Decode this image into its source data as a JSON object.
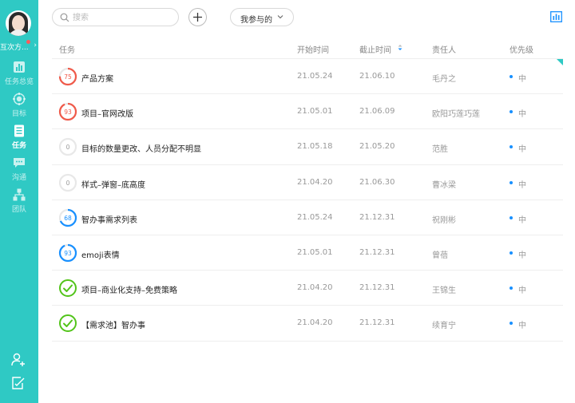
{
  "sidebar": {
    "team_name": "互次方...",
    "items": [
      {
        "label": "任务总览",
        "icon": "bar-chart-icon",
        "active": false
      },
      {
        "label": "目标",
        "icon": "target-icon",
        "active": false
      },
      {
        "label": "任务",
        "icon": "task-list-icon",
        "active": true
      },
      {
        "label": "沟通",
        "icon": "chat-icon",
        "active": false
      },
      {
        "label": "团队",
        "icon": "org-tree-icon",
        "active": false
      }
    ],
    "bottom_icons": [
      "add-user-icon",
      "edit-note-icon"
    ]
  },
  "toolbar": {
    "search_placeholder": "搜索",
    "filter_label": "我参与的"
  },
  "table": {
    "columns": {
      "task": "任务",
      "start": "开始时间",
      "end": "截止时间",
      "owner": "责任人",
      "priority": "优先级"
    },
    "rows": [
      {
        "progress": 75,
        "progress_label": "75",
        "status": "in-progress-overdue",
        "name": "产品方案",
        "start": "21.05.24",
        "end": "21.06.10",
        "owner": "毛丹之",
        "priority": "中",
        "flag": true
      },
      {
        "progress": 93,
        "progress_label": "93",
        "status": "in-progress-overdue",
        "name": "项目–官网改版",
        "start": "21.05.01",
        "end": "21.06.09",
        "owner": "欧阳巧莲巧莲",
        "priority": "中",
        "flag": false
      },
      {
        "progress": 0,
        "progress_label": "0",
        "status": "not-started",
        "name": "目标的数量更改、人员分配不明显",
        "start": "21.05.18",
        "end": "21.05.20",
        "owner": "范胜",
        "priority": "中",
        "flag": false
      },
      {
        "progress": 0,
        "progress_label": "0",
        "status": "not-started",
        "name": "样式–弹窗–底高度",
        "start": "21.04.20",
        "end": "21.06.30",
        "owner": "曹冰梁",
        "priority": "中",
        "flag": false
      },
      {
        "progress": 68,
        "progress_label": "68",
        "status": "in-progress",
        "name": "智办事需求列表",
        "start": "21.05.24",
        "end": "21.12.31",
        "owner": "祝刚彬",
        "priority": "中",
        "flag": false
      },
      {
        "progress": 93,
        "progress_label": "93",
        "status": "in-progress",
        "name": "emoji表情",
        "start": "21.05.01",
        "end": "21.12.31",
        "owner": "曾蓓",
        "priority": "中",
        "flag": false
      },
      {
        "progress": 100,
        "progress_label": "",
        "status": "done",
        "name": "项目–商业化支持–免费策略",
        "start": "21.04.20",
        "end": "21.12.31",
        "owner": "王锦生",
        "priority": "中",
        "flag": false
      },
      {
        "progress": 100,
        "progress_label": "",
        "status": "done",
        "name": "【需求池】智办事",
        "start": "21.04.20",
        "end": "21.12.31",
        "owner": "续育宁",
        "priority": "中",
        "flag": false
      }
    ]
  },
  "colors": {
    "accent": "#2fc9c4",
    "overdue": "#f05a4a",
    "in_progress": "#1890ff",
    "done": "#52c41a",
    "not_started": "#dddddd",
    "priority_dot": "#1890ff"
  }
}
